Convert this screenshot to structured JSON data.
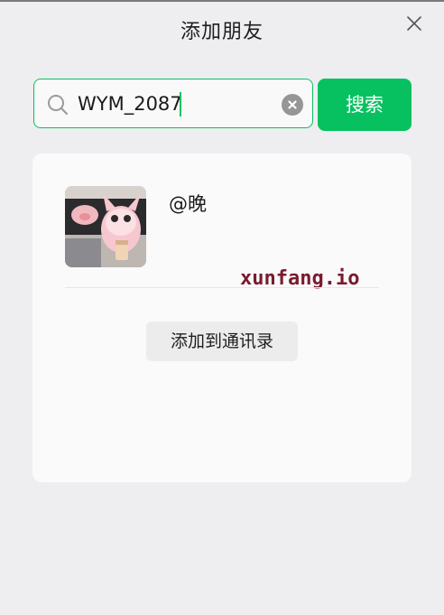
{
  "dialog": {
    "title": "添加朋友"
  },
  "search": {
    "value": "WYM_2087",
    "button_label": "搜索",
    "accent_color": "#07c160"
  },
  "result": {
    "nickname": "@晚",
    "add_button_label": "添加到通讯录"
  },
  "watermark": {
    "text": "xunfang.io"
  },
  "icons": {
    "close": "close-icon",
    "search": "search-icon",
    "clear": "clear-icon"
  }
}
